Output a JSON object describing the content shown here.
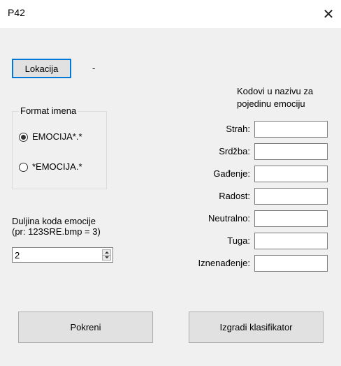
{
  "window": {
    "title": "P42",
    "close_glyph": "✕"
  },
  "location": {
    "button_label": "Lokacija",
    "value": "-"
  },
  "name_format": {
    "legend": "Format imena",
    "options": [
      {
        "label": "EMOCIJA*.*",
        "checked": true
      },
      {
        "label": "*EMOCIJA.*",
        "checked": false
      }
    ]
  },
  "code_length": {
    "label_line1": "Duljina koda emocije",
    "label_line2": "(pr: 123SRE.bmp = 3)",
    "value": "2"
  },
  "emotion_codes": {
    "header_line1": "Kodovi u nazivu za",
    "header_line2": "pojedinu emociju",
    "fields": [
      {
        "label": "Strah:",
        "value": ""
      },
      {
        "label": "Srdžba:",
        "value": ""
      },
      {
        "label": "Gađenje:",
        "value": ""
      },
      {
        "label": "Radost:",
        "value": ""
      },
      {
        "label": "Neutralno:",
        "value": ""
      },
      {
        "label": "Tuga:",
        "value": ""
      },
      {
        "label": "Iznenađenje:",
        "value": ""
      }
    ]
  },
  "actions": {
    "run_label": "Pokreni",
    "build_label": "Izgradi klasifikator"
  },
  "icons": {
    "close": "close-icon",
    "spin_up": "chevron-up-icon",
    "spin_down": "chevron-down-icon"
  }
}
